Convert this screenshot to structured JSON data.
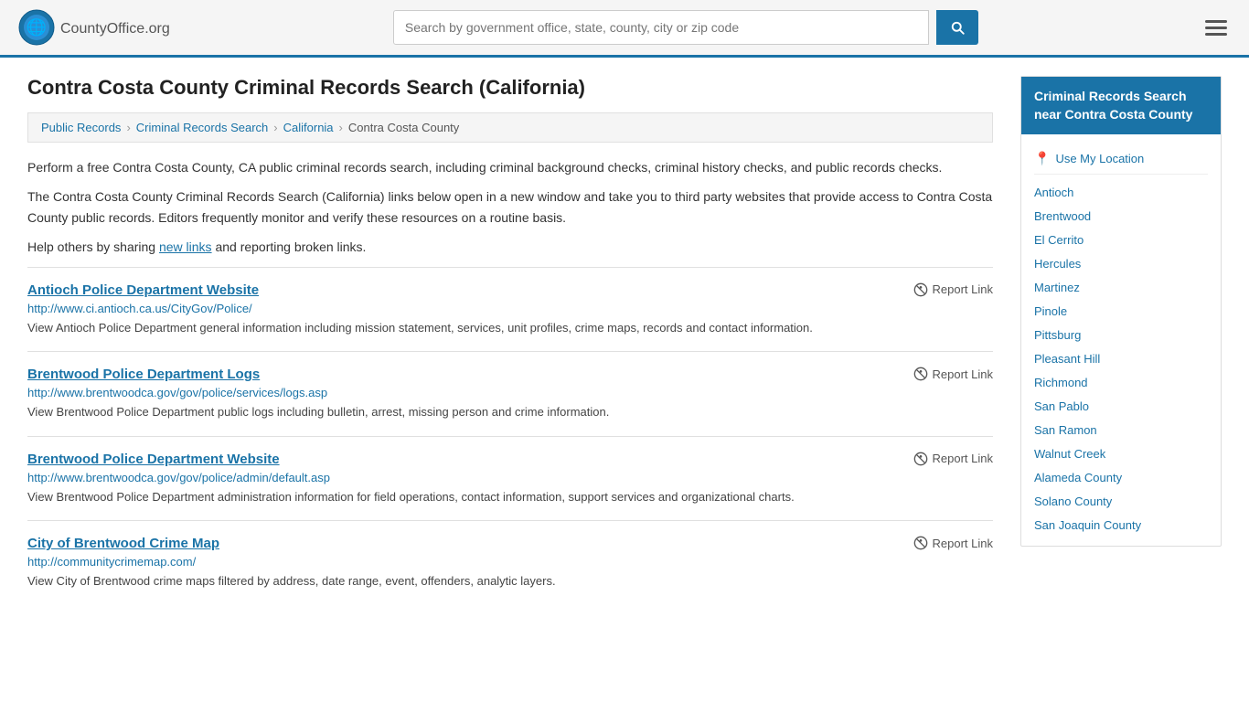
{
  "header": {
    "logo_text": "CountyOffice",
    "logo_suffix": ".org",
    "search_placeholder": "Search by government office, state, county, city or zip code",
    "search_value": ""
  },
  "page": {
    "title": "Contra Costa County Criminal Records Search (California)",
    "breadcrumbs": [
      {
        "label": "Public Records",
        "href": "#"
      },
      {
        "label": "Criminal Records Search",
        "href": "#"
      },
      {
        "label": "California",
        "href": "#"
      },
      {
        "label": "Contra Costa County",
        "href": "#"
      }
    ],
    "description1": "Perform a free Contra Costa County, CA public criminal records search, including criminal background checks, criminal history checks, and public records checks.",
    "description2": "The Contra Costa County Criminal Records Search (California) links below open in a new window and take you to third party websites that provide access to Contra Costa County public records. Editors frequently monitor and verify these resources on a routine basis.",
    "description3_prefix": "Help others by sharing ",
    "new_links_text": "new links",
    "description3_suffix": " and reporting broken links."
  },
  "results": [
    {
      "title": "Antioch Police Department Website",
      "url": "http://www.ci.antioch.ca.us/CityGov/Police/",
      "description": "View Antioch Police Department general information including mission statement, services, unit profiles, crime maps, records and contact information.",
      "report_label": "Report Link"
    },
    {
      "title": "Brentwood Police Department Logs",
      "url": "http://www.brentwoodca.gov/gov/police/services/logs.asp",
      "description": "View Brentwood Police Department public logs including bulletin, arrest, missing person and crime information.",
      "report_label": "Report Link"
    },
    {
      "title": "Brentwood Police Department Website",
      "url": "http://www.brentwoodca.gov/gov/police/admin/default.asp",
      "description": "View Brentwood Police Department administration information for field operations, contact information, support services and organizational charts.",
      "report_label": "Report Link"
    },
    {
      "title": "City of Brentwood Crime Map",
      "url": "http://communitycrimemap.com/",
      "description": "View City of Brentwood crime maps filtered by address, date range, event, offenders, analytic layers.",
      "report_label": "Report Link"
    }
  ],
  "sidebar": {
    "title": "Criminal Records Search near Contra Costa County",
    "use_location_label": "Use My Location",
    "links": [
      "Antioch",
      "Brentwood",
      "El Cerrito",
      "Hercules",
      "Martinez",
      "Pinole",
      "Pittsburg",
      "Pleasant Hill",
      "Richmond",
      "San Pablo",
      "San Ramon",
      "Walnut Creek",
      "Alameda County",
      "Solano County",
      "San Joaquin County"
    ]
  }
}
